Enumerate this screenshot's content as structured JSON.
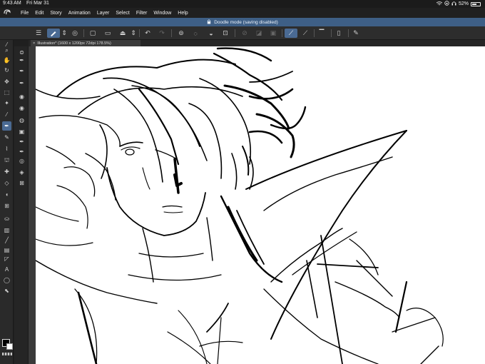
{
  "status": {
    "time": "9:43 AM",
    "date": "Fri Mar 31",
    "battery": "52%",
    "icons": [
      "wifi-icon",
      "orientation-lock-icon",
      "headphones-icon",
      "battery-icon"
    ]
  },
  "menu": {
    "app_icon": "clip-studio-icon",
    "items": [
      "File",
      "Edit",
      "Story",
      "Animation",
      "Layer",
      "Select",
      "Filter",
      "Window",
      "Help"
    ]
  },
  "banner": {
    "text": "Doodle mode (saving disabled)",
    "icon": "lock-icon"
  },
  "canvas_tab": {
    "label": "Illustration* (1600 x 1200px 72dpi 178.5%)",
    "close": "×"
  },
  "colors": {
    "banner": "#3e5f86",
    "active_tool": "#4a6a93",
    "main_color": "#000000",
    "sub_color": "#ffffff"
  }
}
